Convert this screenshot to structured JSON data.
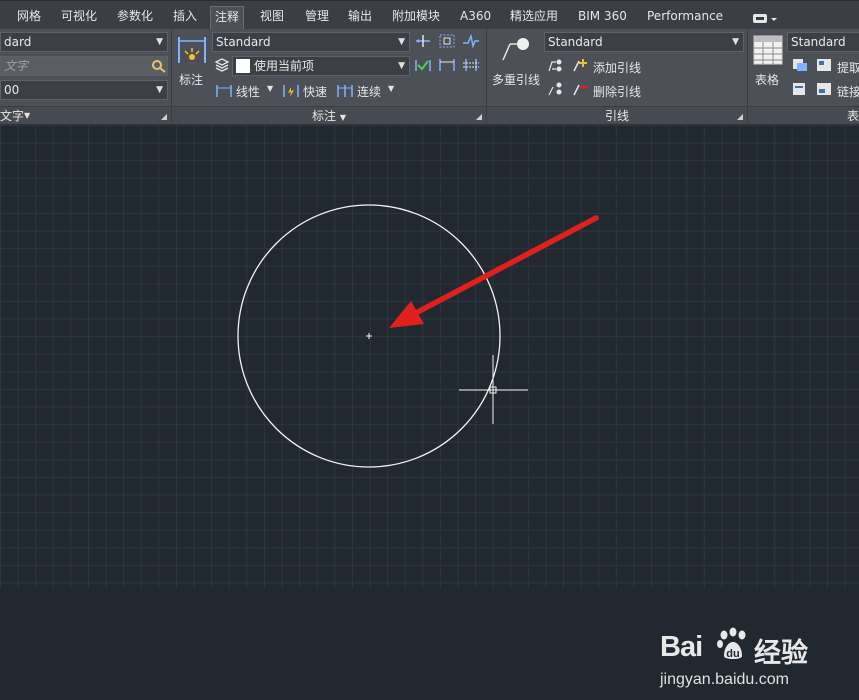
{
  "tabs": [
    "网格",
    "可视化",
    "参数化",
    "插入",
    "注释",
    "视图",
    "管理",
    "输出",
    "附加模块",
    "A360",
    "精选应用",
    "BIM 360",
    "Performance"
  ],
  "active_tab": "注释",
  "text_panel": {
    "style_value": "dard",
    "find_placeholder": "文字",
    "height_value": "00",
    "title": "文字"
  },
  "dim_panel": {
    "big_button_label": "标注",
    "style_value": "Standard",
    "layer_value": "使用当前项",
    "linear_label": "线性",
    "quick_label": "快速",
    "continue_label": "连续",
    "title": "标注"
  },
  "leader_panel": {
    "big_button_label": "多重引线",
    "style_value": "Standard",
    "add_label": "添加引线",
    "remove_label": "删除引线",
    "title": "引线"
  },
  "table_panel": {
    "big_button_label": "表格",
    "style_value": "Standard",
    "extract_label": "提取",
    "link_label": "链接",
    "title": "表"
  },
  "watermark": {
    "brand": "Bai",
    "brand_suffix": "du",
    "product": "经验",
    "url": "jingyan.baidu.com"
  },
  "colors": {
    "arrow": "#e0201c",
    "circle": "#ffffff",
    "grid": "#2d3540",
    "background": "#212830"
  }
}
